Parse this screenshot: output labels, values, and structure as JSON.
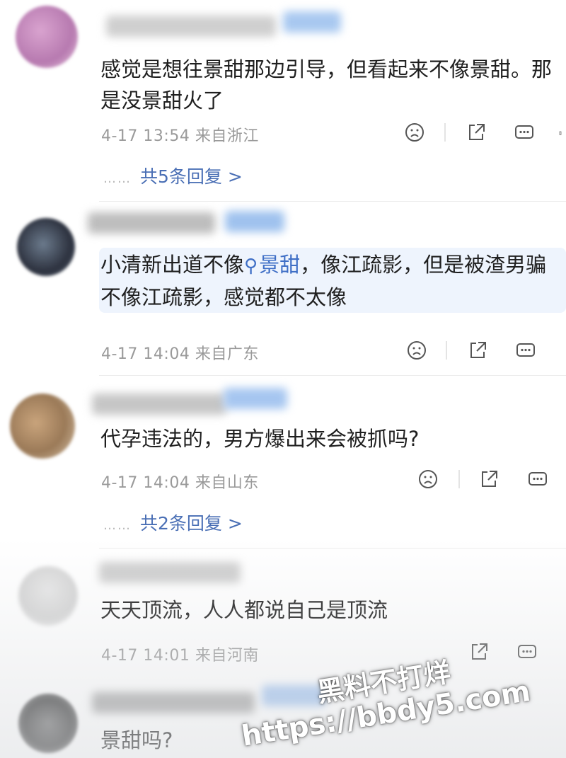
{
  "comments": [
    {
      "text_line1": "感觉是想往景甜那边引导，但看起来不像景甜。那",
      "text_line2": "是没景甜火了",
      "meta": "4-17 13:54 来自浙江",
      "replies": "共5条回复 >"
    },
    {
      "text_prefix": "小清新出道不像",
      "link_text": "景甜",
      "text_suffix": "，像江疏影，但是被渣男骗",
      "text_line2": "不像江疏影，感觉都不太像",
      "meta": "4-17 14:04 来自广东"
    },
    {
      "text_line1": "代孕违法的，男方爆出来会被抓吗?",
      "meta": "4-17 14:04 来自山东",
      "replies": "共2条回复 >"
    },
    {
      "text_line1": "天天顶流，人人都说自己是顶流",
      "meta": "4-17 14:01 来自河南"
    },
    {
      "text_line1": "景甜吗?"
    }
  ],
  "reply_dots": "……",
  "watermark": {
    "line1": "黑料不打烊",
    "line2": "https://bbdy5.com"
  },
  "icons": [
    "sad-face-icon",
    "share-icon",
    "comment-icon"
  ],
  "colors": {
    "link": "#3f6fc6",
    "meta": "#9a9a9a",
    "highlight": "#eef4fd"
  }
}
